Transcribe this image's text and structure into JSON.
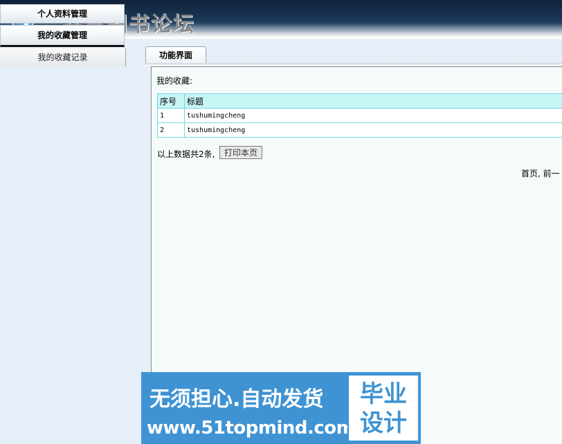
{
  "header": {
    "site_title": "共享图书论坛"
  },
  "sidebar": {
    "menu": [
      {
        "label": "个人资料管理"
      },
      {
        "label": "我的收藏管理"
      }
    ],
    "sub_item": "我的收藏记录"
  },
  "main": {
    "tab_label": "功能界面",
    "heading": "我的收藏:",
    "table": {
      "columns": [
        "序号",
        "标题"
      ],
      "rows": [
        {
          "index": "1",
          "title": "tushumingcheng"
        },
        {
          "index": "2",
          "title": "tushumingcheng"
        }
      ]
    },
    "summary": "以上数据共2条,",
    "print_label": "打印本页",
    "pager": "首页, 前一"
  },
  "watermark": {
    "line1": "无须担心.自动发货",
    "line2": "www.51topmind.com",
    "badge_line1": "毕业",
    "badge_line2": "设计"
  },
  "colors": {
    "header_dark": "#0f2238",
    "table_border": "#6fd8e0",
    "table_header_bg": "#c7f5f6",
    "sidebar_bg": "#e6eef7",
    "watermark_blue": "#3f93d3"
  }
}
